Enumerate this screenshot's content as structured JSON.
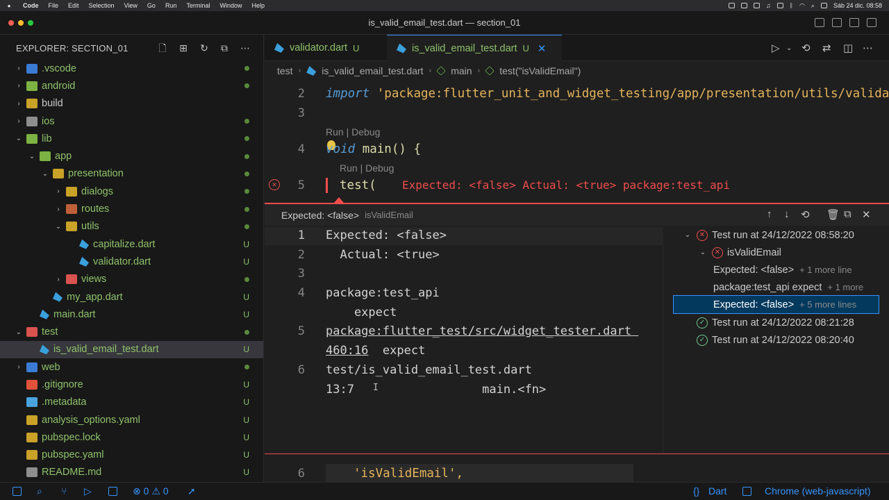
{
  "menubar": {
    "apple": "",
    "items": [
      "Code",
      "File",
      "Edit",
      "Selection",
      "View",
      "Go",
      "Run",
      "Terminal",
      "Window",
      "Help"
    ],
    "clock": "Sáb 24 dic.  08:58"
  },
  "window": {
    "title": "is_valid_email_test.dart — section_01"
  },
  "explorer": {
    "title": "EXPLORER: SECTION_01",
    "tree": [
      {
        "label": ".vscode",
        "chev": "›",
        "indent": 0,
        "icon": "folder-vscode-icon",
        "color": "#3a7bd5",
        "status": "dot"
      },
      {
        "label": "android",
        "chev": "›",
        "indent": 0,
        "icon": "folder-android-icon",
        "color": "#7cb342",
        "status": "dot"
      },
      {
        "label": "build",
        "chev": "›",
        "indent": 0,
        "icon": "folder-build-icon",
        "color": "#c9a227",
        "status": "",
        "plain": true
      },
      {
        "label": "ios",
        "chev": "›",
        "indent": 0,
        "icon": "folder-ios-icon",
        "color": "#8e8e8e",
        "status": "dot"
      },
      {
        "label": "lib",
        "chev": "⌄",
        "indent": 0,
        "icon": "folder-lib-icon",
        "color": "#7cb342",
        "status": "dot"
      },
      {
        "label": "app",
        "chev": "⌄",
        "indent": 1,
        "icon": "folder-app-icon",
        "color": "#7cb342",
        "status": "dot"
      },
      {
        "label": "presentation",
        "chev": "⌄",
        "indent": 2,
        "icon": "folder-icon",
        "color": "#c9a227",
        "status": "dot"
      },
      {
        "label": "dialogs",
        "chev": "›",
        "indent": 3,
        "icon": "folder-icon",
        "color": "#c9a227",
        "status": "dot"
      },
      {
        "label": "routes",
        "chev": "›",
        "indent": 3,
        "icon": "folder-routes-icon",
        "color": "#c0603a",
        "status": "dot"
      },
      {
        "label": "utils",
        "chev": "⌄",
        "indent": 3,
        "icon": "folder-utils-icon",
        "color": "#c9a227",
        "status": "dot"
      },
      {
        "label": "capitalize.dart",
        "chev": "",
        "indent": 4,
        "icon": "dart-file-icon",
        "color": "#3aa0dc",
        "status": "U"
      },
      {
        "label": "validator.dart",
        "chev": "",
        "indent": 4,
        "icon": "dart-file-icon",
        "color": "#3aa0dc",
        "status": "U"
      },
      {
        "label": "views",
        "chev": "›",
        "indent": 3,
        "icon": "folder-views-icon",
        "color": "#d9534f",
        "status": "dot"
      },
      {
        "label": "my_app.dart",
        "chev": "",
        "indent": 2,
        "icon": "dart-file-icon",
        "color": "#3aa0dc",
        "status": "U"
      },
      {
        "label": "main.dart",
        "chev": "",
        "indent": 1,
        "icon": "dart-file-icon",
        "color": "#3aa0dc",
        "status": "U"
      },
      {
        "label": "test",
        "chev": "⌄",
        "indent": 0,
        "icon": "folder-test-icon",
        "color": "#d9534f",
        "status": "dot"
      },
      {
        "label": "is_valid_email_test.dart",
        "chev": "",
        "indent": 1,
        "icon": "dart-file-icon",
        "color": "#3aa0dc",
        "status": "U",
        "selected": true
      },
      {
        "label": "web",
        "chev": "›",
        "indent": 0,
        "icon": "folder-web-icon",
        "color": "#3a7bd5",
        "status": "dot"
      },
      {
        "label": ".gitignore",
        "chev": "",
        "indent": 0,
        "icon": "git-icon",
        "color": "#e0533a",
        "status": "U"
      },
      {
        "label": ".metadata",
        "chev": "",
        "indent": 0,
        "icon": "flutter-icon",
        "color": "#4aa3df",
        "status": "U"
      },
      {
        "label": "analysis_options.yaml",
        "chev": "",
        "indent": 0,
        "icon": "yaml-icon",
        "color": "#c9a227",
        "status": "U"
      },
      {
        "label": "pubspec.lock",
        "chev": "",
        "indent": 0,
        "icon": "lock-file-icon",
        "color": "#c9a227",
        "status": "U"
      },
      {
        "label": "pubspec.yaml",
        "chev": "",
        "indent": 0,
        "icon": "yaml-icon",
        "color": "#c9a227",
        "status": "U"
      },
      {
        "label": "README.md",
        "chev": "",
        "indent": 0,
        "icon": "markdown-icon",
        "color": "#8e8e8e",
        "status": "U"
      }
    ]
  },
  "tabs": [
    {
      "label": "validator.dart",
      "status": "U",
      "active": false
    },
    {
      "label": "is_valid_email_test.dart",
      "status": "U",
      "active": true
    }
  ],
  "breadcrumb": {
    "items": [
      "test",
      "is_valid_email_test.dart",
      "main",
      "test(\"isValidEmail\")"
    ]
  },
  "editor": {
    "line2_num": "2",
    "line2_kw": "import",
    "line2_str": "'package:flutter_unit_and_widget_testing/app/presentation/utils/validator.",
    "line3_num": "3",
    "lens1": "Run | Debug",
    "line4_num": "4",
    "line4_kw": "void",
    "line4_rest": " main() {",
    "lens2": "Run | Debug",
    "line5_num": "5",
    "line5_code": "test(",
    "line5_error": "Expected: <false> Actual: <true> package:test_api"
  },
  "peek": {
    "title": "Expected: <false>",
    "subtitle": "isValidEmail",
    "lines": [
      {
        "num": "1",
        "text": "Expected: <false>"
      },
      {
        "num": "2",
        "text": "  Actual: <true>"
      },
      {
        "num": "3",
        "text": ""
      },
      {
        "num": "4",
        "text": "package:test_api"
      },
      {
        "num": "",
        "text": "    expect"
      },
      {
        "num": "5",
        "text": "package:flutter_test/src/widget_tester.dart ",
        "ul": true
      },
      {
        "num": "",
        "text": "460:16  expect",
        "ul_part": "460:16"
      },
      {
        "num": "6",
        "text": "test/is_valid_email_test.dart"
      },
      {
        "num": "",
        "text": "13:7                  main.<fn>"
      }
    ],
    "results": [
      {
        "label": "Test run at 24/12/2022 08:58:20",
        "state": "fail",
        "chev": "⌄",
        "indent": 0
      },
      {
        "label": "isValidEmail",
        "state": "fail",
        "chev": "⌄",
        "indent": 1
      },
      {
        "label": "Expected: <false>",
        "more": "+ 1 more line",
        "indent": 2
      },
      {
        "label": "package:test_api expect",
        "more": "+ 1 more",
        "indent": 2
      },
      {
        "label": "Expected: <false>",
        "more": "+ 5 more lines",
        "indent": 2,
        "selected": true
      },
      {
        "label": "Test run at 24/12/2022 08:21:28",
        "state": "pass",
        "chev": "",
        "indent": 0
      },
      {
        "label": "Test run at 24/12/2022 08:20:40",
        "state": "pass",
        "chev": "",
        "indent": 0
      }
    ]
  },
  "bottom_code": {
    "line_num": "6",
    "text": "'isValidEmail',"
  },
  "statusbar": {
    "errors": "0",
    "warnings": "0",
    "language": "Dart",
    "debugger": "Chrome (web-javascript)"
  },
  "colors": {
    "accent": "#3794ff",
    "error": "#f14c4c",
    "pass": "#73c991",
    "git_untracked": "#8fc26b"
  }
}
